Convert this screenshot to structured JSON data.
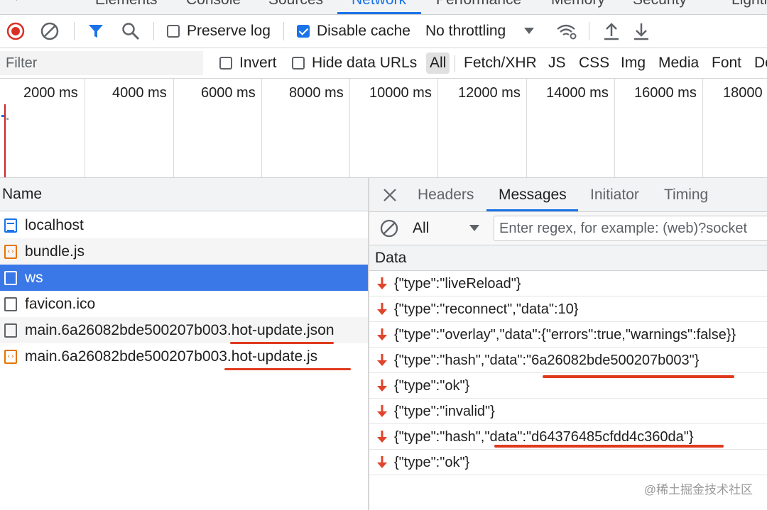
{
  "devtools_tabs": [
    {
      "label": "Elements"
    },
    {
      "label": "Console"
    },
    {
      "label": "Sources"
    },
    {
      "label": "Network"
    },
    {
      "label": "Performance"
    },
    {
      "label": "Memory"
    },
    {
      "label": "Security"
    },
    {
      "label": "Lighth"
    }
  ],
  "toolbar": {
    "preserve_log_label": "Preserve log",
    "disable_cache_label": "Disable cache",
    "throttling_value": "No throttling"
  },
  "filter": {
    "placeholder": "Filter",
    "invert_label": "Invert",
    "hide_data_urls_label": "Hide data URLs",
    "types": [
      "All",
      "Fetch/XHR",
      "JS",
      "CSS",
      "Img",
      "Media",
      "Font",
      "Do"
    ]
  },
  "timeline": {
    "ticks": [
      "2000 ms",
      "4000 ms",
      "6000 ms",
      "8000 ms",
      "10000 ms",
      "12000 ms",
      "14000 ms",
      "16000 ms",
      "18000"
    ]
  },
  "requests": {
    "header": "Name",
    "items": [
      {
        "name": "localhost",
        "icon": "document-icon"
      },
      {
        "name": "bundle.js",
        "icon": "script-icon"
      },
      {
        "name": "ws",
        "icon": "websocket-icon"
      },
      {
        "name": "favicon.ico",
        "icon": "file-icon"
      },
      {
        "name": "main.6a26082bde500207b003.hot-update.json",
        "icon": "file-icon"
      },
      {
        "name": "main.6a26082bde500207b003.hot-update.js",
        "icon": "script-icon"
      }
    ]
  },
  "detail": {
    "tabs": [
      "Headers",
      "Messages",
      "Initiator",
      "Timing"
    ],
    "active_tab": "Messages",
    "message_filter_value": "All",
    "regex_placeholder": "Enter regex, for example: (web)?socket",
    "data_header": "Data",
    "messages": [
      "{\"type\":\"liveReload\"}",
      "{\"type\":\"reconnect\",\"data\":10}",
      "{\"type\":\"overlay\",\"data\":{\"errors\":true,\"warnings\":false}}",
      "{\"type\":\"hash\",\"data\":\"6a26082bde500207b003\"}",
      "{\"type\":\"ok\"}",
      "{\"type\":\"invalid\"}",
      "{\"type\":\"hash\",\"data\":\"d64376485cfdd4c360da\"}",
      "{\"type\":\"ok\"}"
    ]
  },
  "watermark": "@稀土掘金技术社区",
  "colors": {
    "accent_blue": "#1a73e8",
    "selected_row": "#3b78e7",
    "record_red": "#d93025",
    "annotation_red": "#e03a1e",
    "received_arrow": "#e0442a"
  }
}
